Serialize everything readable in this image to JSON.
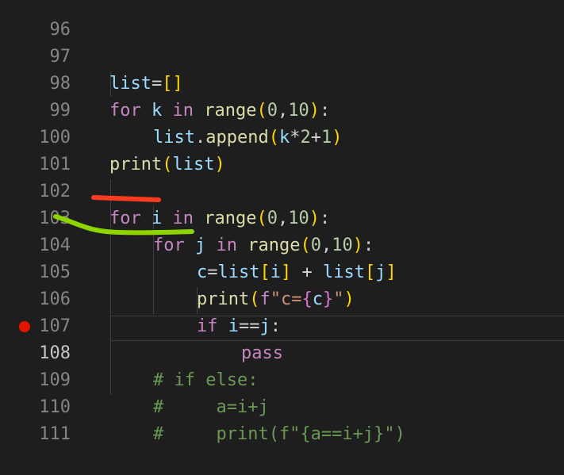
{
  "editor": {
    "line_numbers": [
      "96",
      "97",
      "98",
      "99",
      "100",
      "101",
      "102",
      "103",
      "104",
      "105",
      "106",
      "107",
      "108",
      "109",
      "110",
      "111"
    ],
    "active_line": "108",
    "breakpoint_line": "108",
    "colors": {
      "background": "#1e1e1e",
      "keyword": "#c586c0",
      "function": "#dcdcaa",
      "variable": "#9cdcfe",
      "number": "#b5cea8",
      "comment": "#6a9955",
      "breakpoint": "#e51400",
      "annotation_red": "#ff3b1f",
      "annotation_green": "#8fd400"
    },
    "lines": {
      "l97": {
        "a": "list",
        "b": "=",
        "c": "[",
        "d": "]"
      },
      "l98": {
        "a": "for",
        "b": "k",
        "c": "in",
        "d": "range",
        "e": "(",
        "f": "0",
        "g": ",",
        "h": "10",
        "i": ")",
        "j": ":"
      },
      "l99": {
        "a": "list",
        "b": ".",
        "c": "append",
        "d": "(",
        "e": "k",
        "f": "*",
        "g": "2",
        "h": "+",
        "i": "1",
        "j": ")"
      },
      "l100": {
        "a": "print",
        "b": "(",
        "c": "list",
        "d": ")"
      },
      "l102": {
        "a": "for",
        "b": "i",
        "c": "in",
        "d": "range",
        "e": "(",
        "f": "0",
        "g": ",",
        "h": "10",
        "i": ")",
        "j": ":"
      },
      "l103": {
        "a": "for",
        "b": "j",
        "c": "in",
        "d": "range",
        "e": "(",
        "f": "0",
        "g": ",",
        "h": "10",
        "i": ")",
        "j": ":"
      },
      "l104": {
        "a": "c",
        "b": "=",
        "c": "list",
        "d": "[",
        "e": "i",
        "f": "]",
        "g": " + ",
        "h": "list",
        "i": "[",
        "j": "j",
        "k": "]"
      },
      "l105": {
        "a": "print",
        "b": "(",
        "c": "f",
        "d": "\"c=",
        "e": "{",
        "f": "c",
        "g": "}",
        "h": "\"",
        "i": ")"
      },
      "l106": {
        "a": "if",
        "b": "i",
        "c": "==",
        "d": "j",
        "e": ":"
      },
      "l107": {
        "a": "pass"
      },
      "l108": {
        "a": "# if else:"
      },
      "l109": {
        "a": "#     a=i+j"
      },
      "l110": {
        "a": "#     print(f\"{a==i+j}\")"
      }
    }
  }
}
